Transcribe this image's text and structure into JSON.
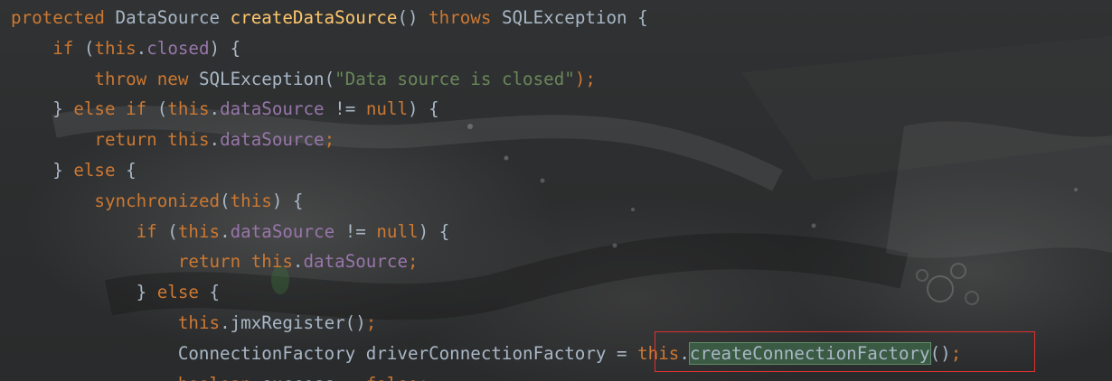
{
  "lines": [
    [
      {
        "t": "protected",
        "c": "kw"
      },
      {
        "t": " DataSource ",
        "c": "pl"
      },
      {
        "t": "createDataSource",
        "c": "fn"
      },
      {
        "t": "() ",
        "c": "pl"
      },
      {
        "t": "throws",
        "c": "kw"
      },
      {
        "t": " SQLException {",
        "c": "pl"
      }
    ],
    [
      {
        "t": "    ",
        "c": "pl"
      },
      {
        "t": "if",
        "c": "kw"
      },
      {
        "t": " (",
        "c": "pl"
      },
      {
        "t": "this",
        "c": "kw"
      },
      {
        "t": ".",
        "c": "pl"
      },
      {
        "t": "closed",
        "c": "fld"
      },
      {
        "t": ") {",
        "c": "pl"
      }
    ],
    [
      {
        "t": "        ",
        "c": "pl"
      },
      {
        "t": "throw new",
        "c": "kw"
      },
      {
        "t": " SQLException(",
        "c": "pl"
      },
      {
        "t": "\"Data source is closed\"",
        "c": "str"
      },
      {
        "t": ");",
        "c": "kw"
      }
    ],
    [
      {
        "t": "    } ",
        "c": "pl"
      },
      {
        "t": "else if",
        "c": "kw"
      },
      {
        "t": " (",
        "c": "pl"
      },
      {
        "t": "this",
        "c": "kw"
      },
      {
        "t": ".",
        "c": "pl"
      },
      {
        "t": "dataSource",
        "c": "fld"
      },
      {
        "t": " != ",
        "c": "pl"
      },
      {
        "t": "null",
        "c": "kw"
      },
      {
        "t": ") {",
        "c": "pl"
      }
    ],
    [
      {
        "t": "        ",
        "c": "pl"
      },
      {
        "t": "return this",
        "c": "kw"
      },
      {
        "t": ".",
        "c": "pl"
      },
      {
        "t": "dataSource",
        "c": "fld"
      },
      {
        "t": ";",
        "c": "kw"
      }
    ],
    [
      {
        "t": "    } ",
        "c": "pl"
      },
      {
        "t": "else",
        "c": "kw"
      },
      {
        "t": " {",
        "c": "pl"
      }
    ],
    [
      {
        "t": "        ",
        "c": "pl"
      },
      {
        "t": "synchronized",
        "c": "kw"
      },
      {
        "t": "(",
        "c": "pl"
      },
      {
        "t": "this",
        "c": "kw"
      },
      {
        "t": ") {",
        "c": "pl"
      }
    ],
    [
      {
        "t": "            ",
        "c": "pl"
      },
      {
        "t": "if",
        "c": "kw"
      },
      {
        "t": " (",
        "c": "pl"
      },
      {
        "t": "this",
        "c": "kw"
      },
      {
        "t": ".",
        "c": "pl"
      },
      {
        "t": "dataSource",
        "c": "fld"
      },
      {
        "t": " != ",
        "c": "pl"
      },
      {
        "t": "null",
        "c": "kw"
      },
      {
        "t": ") {",
        "c": "pl"
      }
    ],
    [
      {
        "t": "                ",
        "c": "pl"
      },
      {
        "t": "return this",
        "c": "kw"
      },
      {
        "t": ".",
        "c": "pl"
      },
      {
        "t": "dataSource",
        "c": "fld"
      },
      {
        "t": ";",
        "c": "kw"
      }
    ],
    [
      {
        "t": "            } ",
        "c": "pl"
      },
      {
        "t": "else",
        "c": "kw"
      },
      {
        "t": " {",
        "c": "pl"
      }
    ],
    [
      {
        "t": "                ",
        "c": "pl"
      },
      {
        "t": "this",
        "c": "kw"
      },
      {
        "t": ".jmxRegister()",
        "c": "pl"
      },
      {
        "t": ";",
        "c": "kw"
      }
    ],
    [
      {
        "t": "                ConnectionFactory driverConnectionFactory = ",
        "c": "pl"
      },
      {
        "t": "this",
        "c": "kw"
      },
      {
        "t": ".",
        "c": "pl"
      },
      {
        "t": "createConnectionFactory",
        "c": "pl hl"
      },
      {
        "t": "()",
        "c": "pl"
      },
      {
        "t": ";",
        "c": "kw"
      }
    ],
    [
      {
        "t": "                ",
        "c": "pl"
      },
      {
        "t": "boolean",
        "c": "kw"
      },
      {
        "t": " success = ",
        "c": "pl"
      },
      {
        "t": "false",
        "c": "kw"
      },
      {
        "t": ";",
        "c": "kw"
      }
    ]
  ]
}
